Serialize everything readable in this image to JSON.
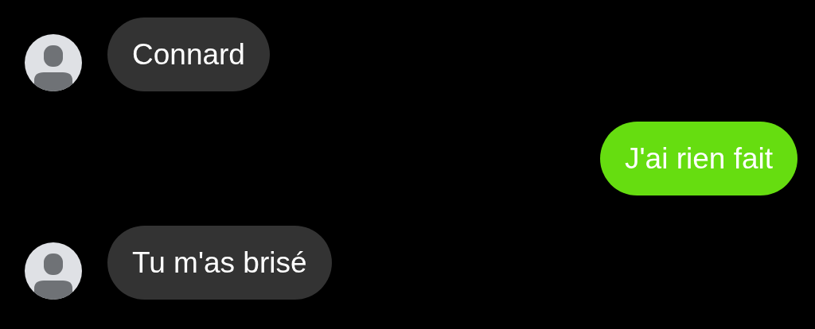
{
  "messages": [
    {
      "kind": "incoming",
      "text": "Connard"
    },
    {
      "kind": "outgoing",
      "text": "J'ai rien fait"
    },
    {
      "kind": "incoming",
      "text": "Tu m'as brisé"
    }
  ]
}
